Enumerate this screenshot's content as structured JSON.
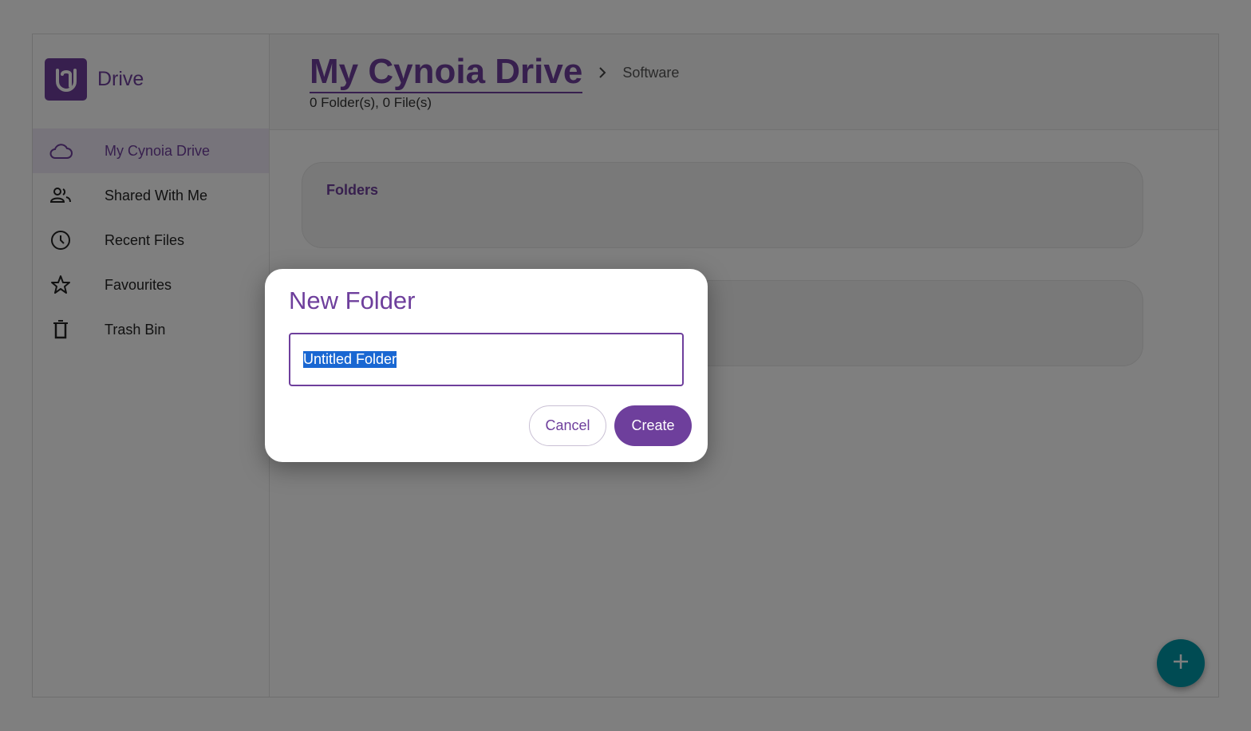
{
  "sidebar": {
    "brand": {
      "name": "Drive",
      "logo_icon": "cynoia-logo-icon",
      "color": "#6e3f9c"
    },
    "items": [
      {
        "label": "My Cynoia Drive",
        "icon": "cloud-icon",
        "active": true
      },
      {
        "label": "Shared With Me",
        "icon": "people-icon",
        "active": false
      },
      {
        "label": "Recent Files",
        "icon": "clock-icon",
        "active": false
      },
      {
        "label": "Favourites",
        "icon": "star-icon",
        "active": false
      },
      {
        "label": "Trash Bin",
        "icon": "trash-icon",
        "active": false
      }
    ]
  },
  "header": {
    "title": "My Cynoia Drive",
    "breadcrumb": "Software",
    "counts": "0 Folder(s), 0 File(s)"
  },
  "main": {
    "folders_title": "Folders",
    "files_title": ""
  },
  "fab": {
    "icon": "plus-icon",
    "color": "#0097a7"
  },
  "dialog": {
    "title": "New Folder",
    "input_value": "Untitled Folder",
    "cancel_label": "Cancel",
    "create_label": "Create"
  },
  "colors": {
    "accent": "#6e3f9c",
    "active_bg": "#efe9f6",
    "overlay": "rgba(0,0,0,0.5)"
  }
}
